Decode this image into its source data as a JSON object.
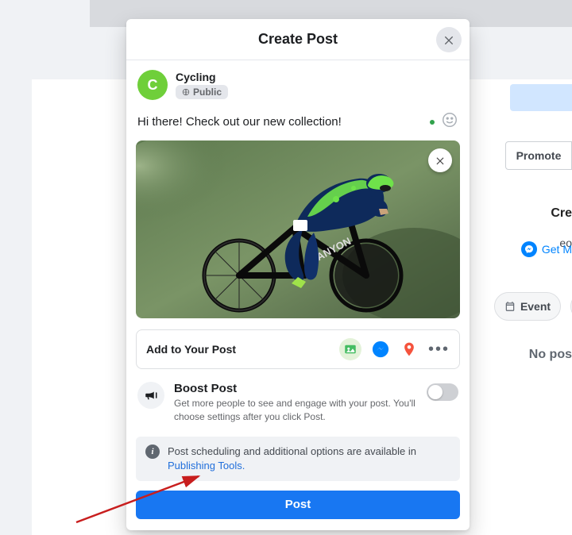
{
  "bg": {
    "promote": "Promote",
    "cre": "Cre",
    "eo": "eo",
    "getm": "Get M",
    "event": "Event",
    "nopos": "No pos"
  },
  "modal": {
    "title": "Create Post",
    "author": {
      "initial": "C",
      "name": "Cycling",
      "privacy": "Public"
    },
    "composer_text": "Hi there! Check out our new collection!",
    "add_label": "Add to Your Post",
    "boost": {
      "title": "Boost Post",
      "desc": "Get more people to see and engage with your post. You'll choose settings after you click Post."
    },
    "info": {
      "text": "Post scheduling and additional options are available in ",
      "link": "Publishing Tools."
    },
    "post_button": "Post"
  }
}
